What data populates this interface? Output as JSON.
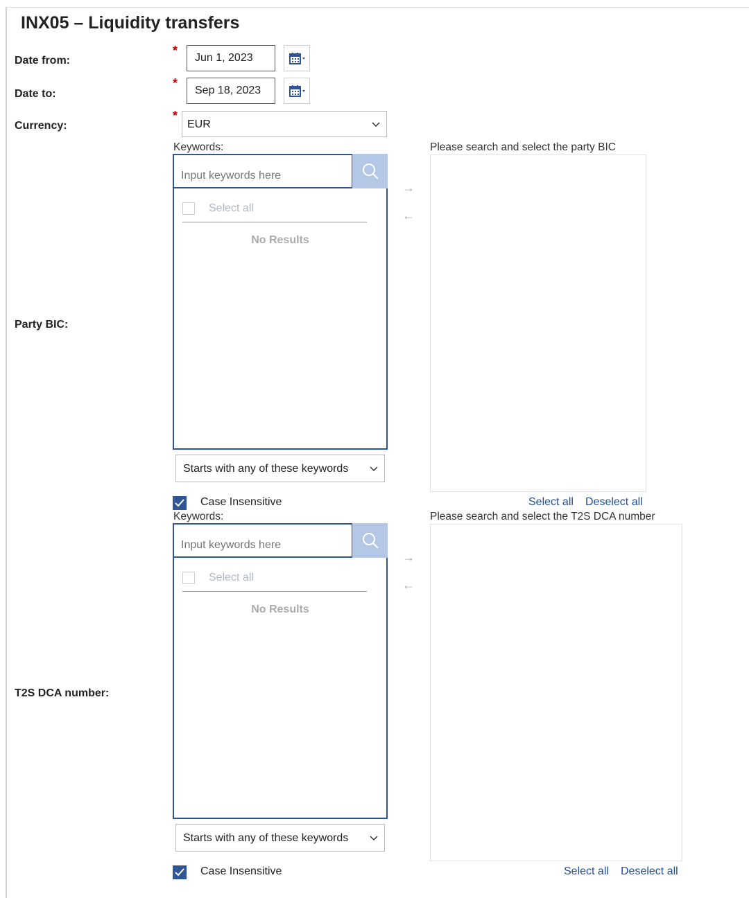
{
  "page": {
    "title": "INX05 – Liquidity transfers"
  },
  "fields": {
    "date_from": {
      "label": "Date from:",
      "value": "Jun 1, 2023",
      "required_mark": "*"
    },
    "date_to": {
      "label": "Date to:",
      "value": "Sep 18, 2023",
      "required_mark": "*"
    },
    "currency": {
      "label": "Currency:",
      "value": "EUR",
      "required_mark": "*"
    }
  },
  "party_bic": {
    "label": "Party BIC:",
    "keywords_label": "Keywords:",
    "search_placeholder": "Input keywords here",
    "select_all": "Select all",
    "no_results": "No Results",
    "target_label": "Please search and select the party BIC",
    "match_mode": "Starts with any of these keywords",
    "case_insensitive_label": "Case Insensitive",
    "case_insensitive_checked": true,
    "link_select_all": "Select all",
    "link_deselect_all": "Deselect all"
  },
  "t2s_dca": {
    "label": "T2S DCA number:",
    "keywords_label": "Keywords:",
    "search_placeholder": "Input keywords here",
    "select_all": "Select all",
    "no_results": "No Results",
    "target_label": "Please search and select the T2S DCA number",
    "match_mode": "Starts with any of these keywords",
    "case_insensitive_label": "Case Insensitive",
    "case_insensitive_checked": true,
    "link_select_all": "Select all",
    "link_deselect_all": "Deselect all"
  },
  "icons": {
    "calendar": "calendar-icon",
    "search": "search-icon",
    "move_right": "arrow-right-icon",
    "move_left": "arrow-left-icon",
    "dropdown": "chevron-down-icon",
    "checkbox_check": "check-icon"
  },
  "transfer_arrows": {
    "right": "→",
    "left": "←"
  },
  "colors": {
    "accent": "#2f5597",
    "search_button": "#b4c7e7",
    "required": "#c00000",
    "link": "#1f4e9a"
  }
}
